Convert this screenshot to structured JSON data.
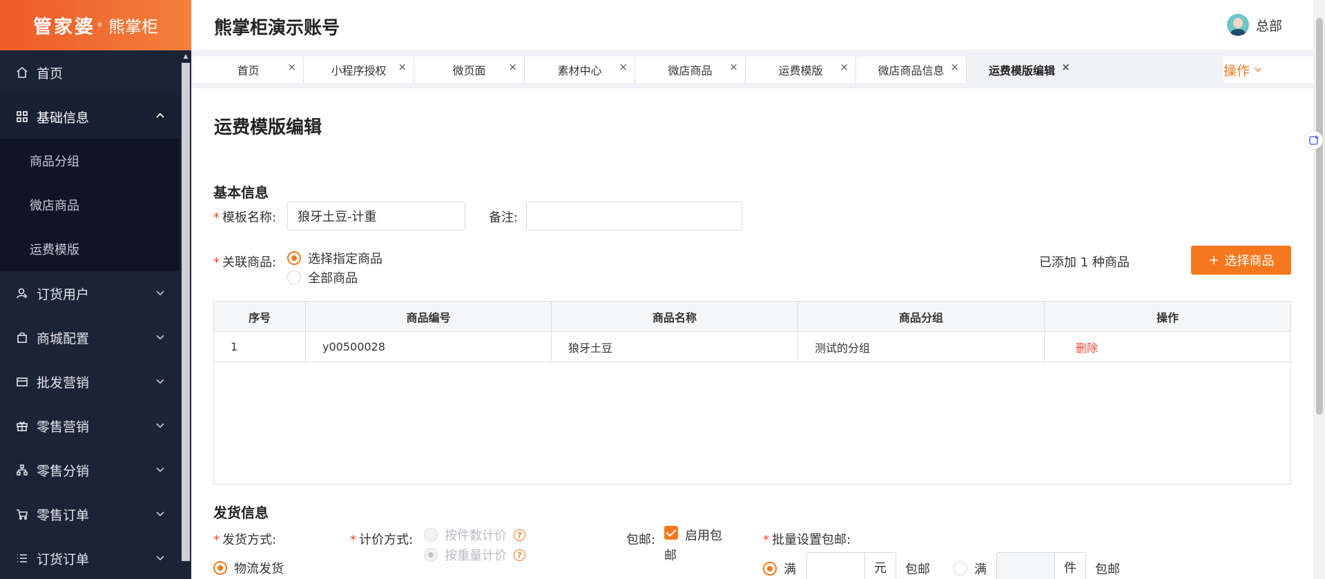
{
  "brand": {
    "name_main": "管家婆",
    "reg_mark": "®",
    "name_sub": "熊掌柜"
  },
  "sidebar": {
    "items": [
      {
        "label": "首页",
        "icon": "home-icon"
      },
      {
        "label": "基础信息",
        "icon": "grid-icon",
        "expanded": true,
        "children": [
          {
            "label": "商品分组"
          },
          {
            "label": "微店商品"
          },
          {
            "label": "运费模版"
          }
        ]
      },
      {
        "label": "订货用户",
        "icon": "user-icon"
      },
      {
        "label": "商城配置",
        "icon": "bag-icon"
      },
      {
        "label": "批发营销",
        "icon": "card-icon"
      },
      {
        "label": "零售营销",
        "icon": "gift-icon"
      },
      {
        "label": "零售分销",
        "icon": "share-tree-icon"
      },
      {
        "label": "零售订单",
        "icon": "cart-icon"
      },
      {
        "label": "订货订单",
        "icon": "list-icon"
      }
    ]
  },
  "header": {
    "account": "熊掌柜演示账号",
    "user": "总部"
  },
  "tabs": [
    {
      "label": "首页"
    },
    {
      "label": "小程序授权"
    },
    {
      "label": "微页面"
    },
    {
      "label": "素材中心"
    },
    {
      "label": "微店商品"
    },
    {
      "label": "运费模版"
    },
    {
      "label": "微店商品信息"
    },
    {
      "label": "运费模版编辑",
      "active": true
    }
  ],
  "tab_close": "×",
  "ops_label": "操作",
  "page": {
    "title": "运费模版编辑",
    "basic_section": "基本信息",
    "template_name_label": "模板名称:",
    "template_name_value": "狼牙土豆-计重",
    "remark_label": "备注:",
    "remark_value": "",
    "related_label": "关联商品:",
    "related_options": [
      "选择指定商品",
      "全部商品"
    ],
    "related_selected": 0,
    "added_text": "已添加 1 种商品",
    "select_button": "选择商品",
    "table": {
      "headers": [
        "序号",
        "商品编号",
        "商品名称",
        "商品分组",
        "操作"
      ],
      "rows": [
        [
          "1",
          "y00500028",
          "狼牙土豆",
          "测试的分组",
          "删除"
        ]
      ]
    },
    "ship_section": "发货信息",
    "ship_method_label": "发货方式:",
    "ship_method_value": "物流发货",
    "pricing_label": "计价方式:",
    "pricing_options": [
      "按件数计价",
      "按重量计价"
    ],
    "pricing_selected": 1,
    "free_ship_label": "包邮:",
    "free_ship_check_1": "启用包",
    "free_ship_check_2": "邮",
    "free_ship_enabled": true,
    "batch_label": "批量设置包邮:",
    "batch_full": "满",
    "batch_unit_yuan": "元",
    "batch_free": "包邮",
    "batch_unit_jian": "件",
    "accent_color": "#f5781e"
  }
}
